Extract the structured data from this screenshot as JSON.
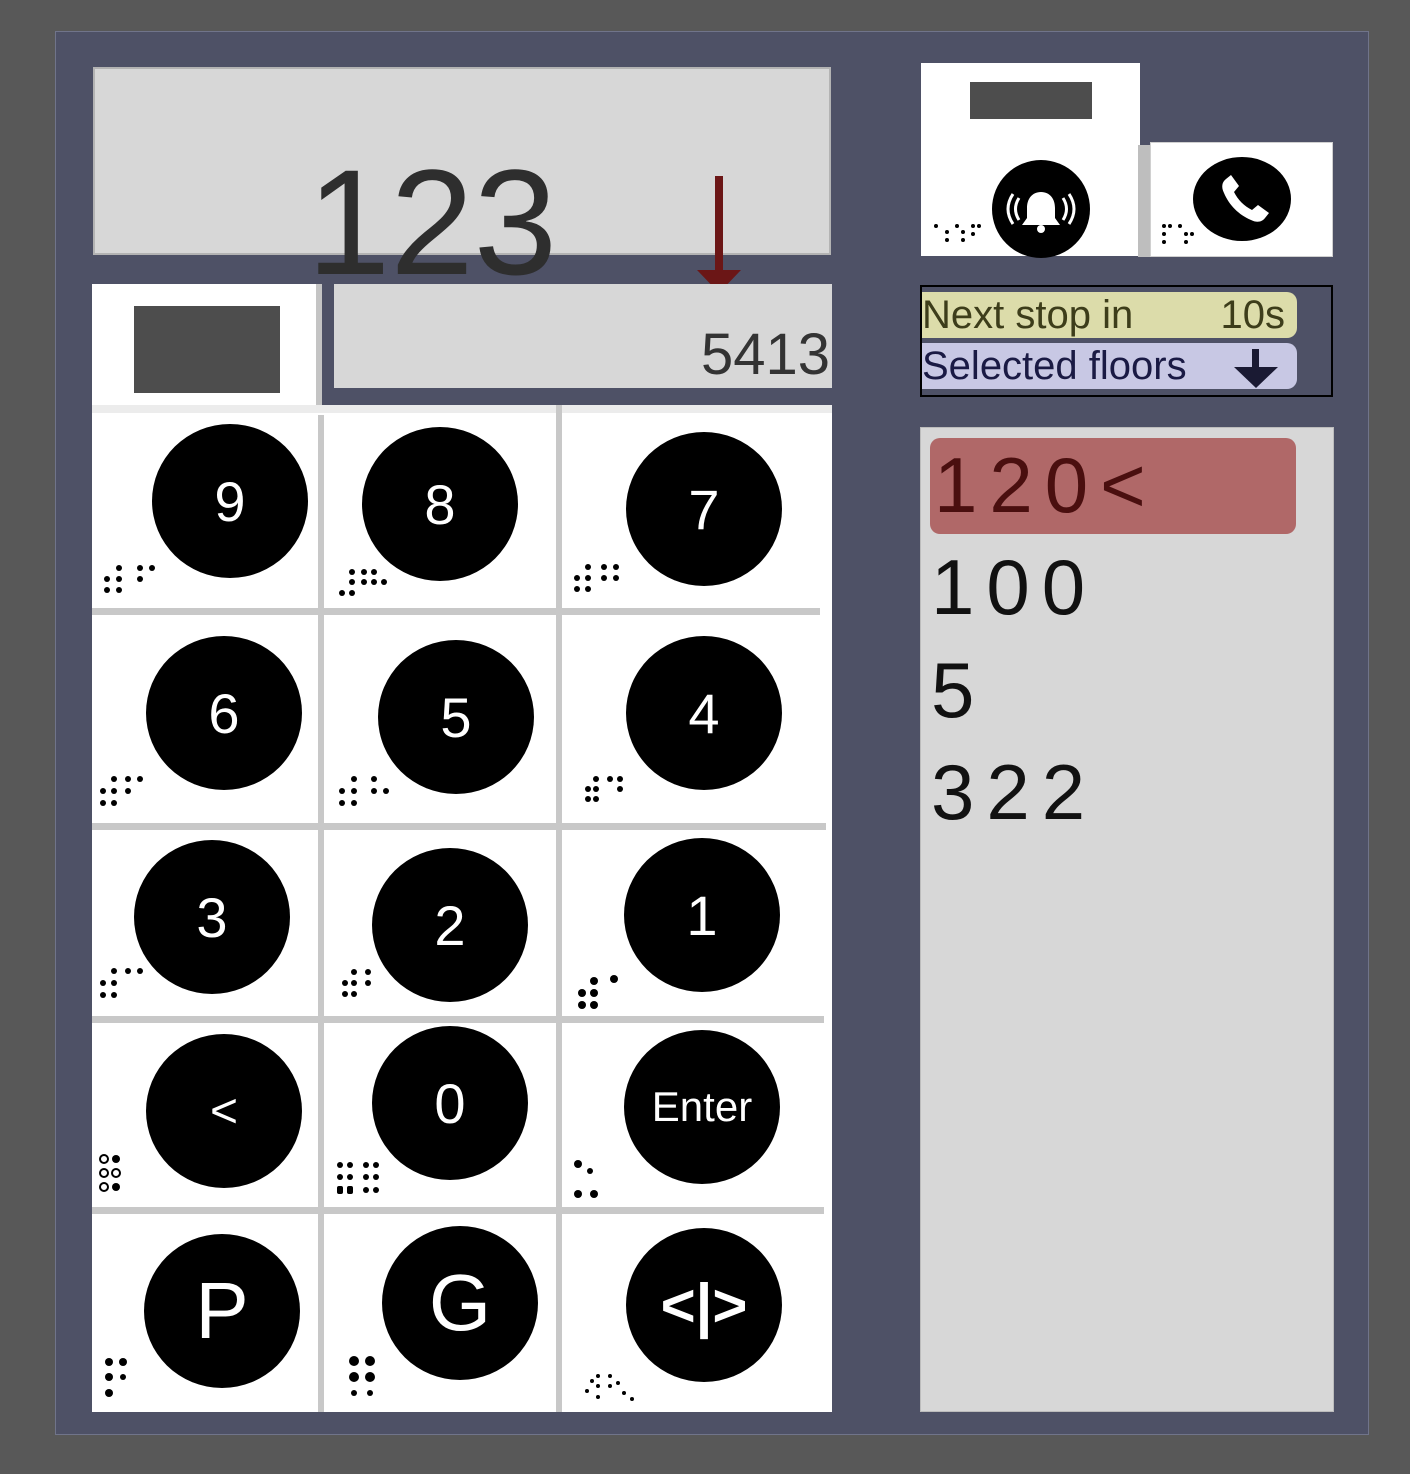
{
  "display": {
    "current_floor": "123",
    "direction_icon": "down-arrow-icon",
    "accent_color": "#6b1616"
  },
  "entry": {
    "value": "5413"
  },
  "controls": {
    "alarm_icon": "alarm-bell-icon",
    "phone_icon": "phone-icon"
  },
  "keypad": {
    "keys": [
      {
        "label": "9"
      },
      {
        "label": "8"
      },
      {
        "label": "7"
      },
      {
        "label": "6"
      },
      {
        "label": "5"
      },
      {
        "label": "4"
      },
      {
        "label": "3"
      },
      {
        "label": "2"
      },
      {
        "label": "1"
      },
      {
        "label": "<"
      },
      {
        "label": "0"
      },
      {
        "label": "Enter"
      },
      {
        "label": "P"
      },
      {
        "label": "G"
      },
      {
        "label": "<|>"
      }
    ]
  },
  "status": {
    "next_stop_label": "Next stop in",
    "next_stop_value": "10s",
    "selected_floors_label": "Selected floors",
    "selected_direction_icon": "down-arrow-icon"
  },
  "floors": {
    "items": [
      "120<",
      "100",
      "5",
      "322"
    ],
    "active_color": "#b06868"
  }
}
